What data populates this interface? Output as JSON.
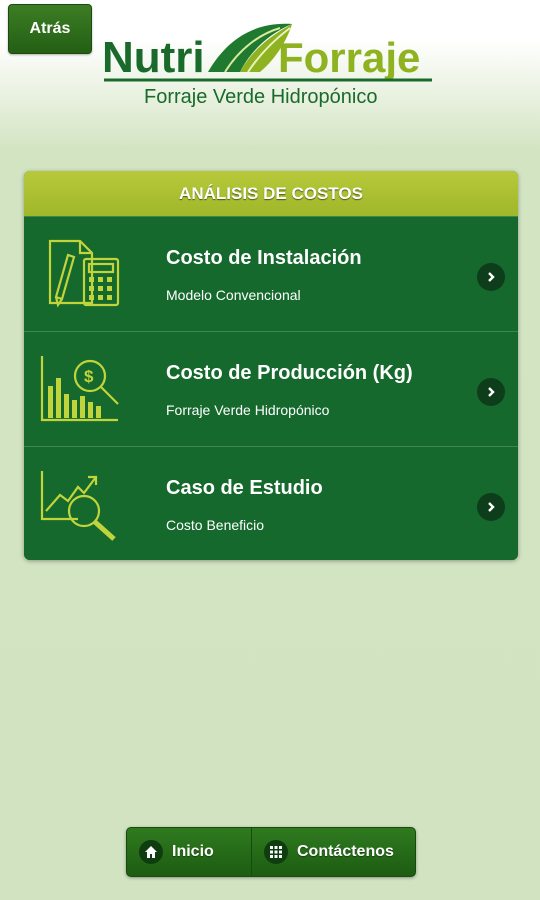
{
  "header": {
    "back_label": "Atrás",
    "logo": {
      "name_left": "Nutri",
      "name_right": "Forraje",
      "tagline": "Forraje Verde Hidropónico"
    }
  },
  "panel": {
    "title": "ANÁLISIS DE COSTOS",
    "items": [
      {
        "title": "Costo de Instalación",
        "subtitle": "Modelo Convencional",
        "icon": "document-calculator-icon"
      },
      {
        "title": "Costo de Producción (Kg)",
        "subtitle": "Forraje Verde Hidropónico",
        "icon": "bar-chart-magnifier-icon"
      },
      {
        "title": "Caso de Estudio",
        "subtitle": "Costo Beneficio",
        "icon": "trend-magnifier-icon"
      }
    ]
  },
  "footer": {
    "home_label": "Inicio",
    "contact_label": "Contáctenos"
  },
  "colors": {
    "background": "#d2e3c1",
    "panel": "#16692e",
    "header_bar": "#a9bf30",
    "icon_line": "#c2d43c",
    "logo_green": "#1a6b2b",
    "logo_lime": "#8fb320"
  }
}
